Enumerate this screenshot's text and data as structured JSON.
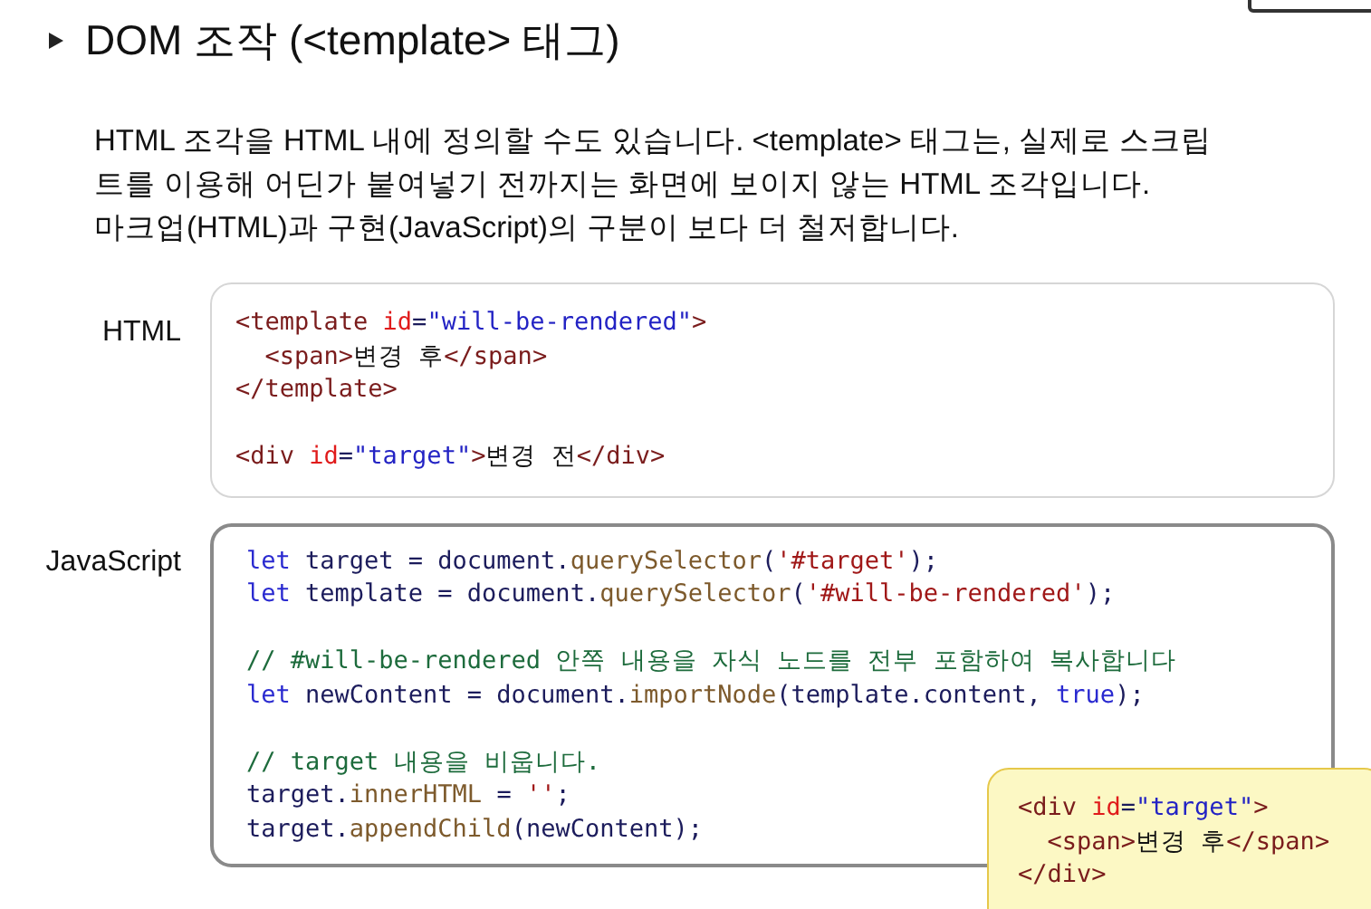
{
  "title": "DOM 조작 (<template> 태그)",
  "description": "HTML 조각을 HTML 내에 정의할 수도 있습니다. <template> 태그는, 실제로 스크립\n트를 이용해 어딘가 붙여넣기 전까지는 화면에 보이지 않는 HTML 조각입니다.\n마크업(HTML)과 구현(JavaScript)의 구분이 보다 더 철저합니다.",
  "panels": [
    {
      "label": "HTML",
      "lines": [
        {
          "kind": "code",
          "tokens": [
            {
              "text": "<template ",
              "kind": "tag"
            },
            {
              "text": "id",
              "kind": "attr"
            },
            {
              "text": "=",
              "kind": "plain"
            },
            {
              "text": "\"will-be-rendered\"",
              "kind": "str"
            },
            {
              "text": ">",
              "kind": "tag"
            }
          ]
        },
        {
          "kind": "code",
          "tokens": [
            {
              "text": "  <span>",
              "kind": "tag"
            },
            {
              "text": "변경 후",
              "kind": "text"
            },
            {
              "text": "</span>",
              "kind": "tag"
            }
          ]
        },
        {
          "kind": "code",
          "tokens": [
            {
              "text": "</template>",
              "kind": "tag"
            }
          ]
        },
        {
          "kind": "blank"
        },
        {
          "kind": "code",
          "tokens": [
            {
              "text": "<div ",
              "kind": "tag"
            },
            {
              "text": "id",
              "kind": "attr"
            },
            {
              "text": "=",
              "kind": "plain"
            },
            {
              "text": "\"target\"",
              "kind": "str"
            },
            {
              "text": ">",
              "kind": "tag"
            },
            {
              "text": "변경 전",
              "kind": "text"
            },
            {
              "text": "</div>",
              "kind": "tag"
            }
          ]
        }
      ]
    },
    {
      "label": "JavaScript",
      "lines": [
        {
          "kind": "code",
          "tokens": [
            {
              "text": "let ",
              "kind": "kw"
            },
            {
              "text": "target = document.",
              "kind": "plain"
            },
            {
              "text": "querySelector",
              "kind": "fn"
            },
            {
              "text": "(",
              "kind": "plain"
            },
            {
              "text": "'#target'",
              "kind": "jsstr"
            },
            {
              "text": ");",
              "kind": "plain"
            }
          ]
        },
        {
          "kind": "code",
          "tokens": [
            {
              "text": "let ",
              "kind": "kw"
            },
            {
              "text": "template = document.",
              "kind": "plain"
            },
            {
              "text": "querySelector",
              "kind": "fn"
            },
            {
              "text": "(",
              "kind": "plain"
            },
            {
              "text": "'#will-be-rendered'",
              "kind": "jsstr"
            },
            {
              "text": ");",
              "kind": "plain"
            }
          ]
        },
        {
          "kind": "blank"
        },
        {
          "kind": "code",
          "tokens": [
            {
              "text": "// #will-be-rendered 안쪽 내용을 자식 노드를 전부 포함하여 복사합니다",
              "kind": "comment"
            }
          ]
        },
        {
          "kind": "code",
          "tokens": [
            {
              "text": "let ",
              "kind": "kw"
            },
            {
              "text": "newContent = document.",
              "kind": "plain"
            },
            {
              "text": "importNode",
              "kind": "fn"
            },
            {
              "text": "(template.content, ",
              "kind": "plain"
            },
            {
              "text": "true",
              "kind": "kw"
            },
            {
              "text": ");",
              "kind": "plain"
            }
          ]
        },
        {
          "kind": "blank"
        },
        {
          "kind": "code",
          "tokens": [
            {
              "text": "// target 내용을 비웁니다.",
              "kind": "comment"
            }
          ]
        },
        {
          "kind": "code",
          "tokens": [
            {
              "text": "target.",
              "kind": "plain"
            },
            {
              "text": "innerHTML",
              "kind": "fn"
            },
            {
              "text": " = ",
              "kind": "plain"
            },
            {
              "text": "''",
              "kind": "jsstr"
            },
            {
              "text": ";",
              "kind": "plain"
            }
          ]
        },
        {
          "kind": "code",
          "tokens": [
            {
              "text": "target.",
              "kind": "plain"
            },
            {
              "text": "appendChild",
              "kind": "fn"
            },
            {
              "text": "(newContent);",
              "kind": "plain"
            }
          ]
        }
      ]
    }
  ],
  "result_note": {
    "lines": [
      {
        "kind": "code",
        "tokens": [
          {
            "text": "<div ",
            "kind": "tag"
          },
          {
            "text": "id",
            "kind": "attr"
          },
          {
            "text": "=",
            "kind": "plain"
          },
          {
            "text": "\"target\"",
            "kind": "str"
          },
          {
            "text": ">",
            "kind": "tag"
          }
        ]
      },
      {
        "kind": "code",
        "tokens": [
          {
            "text": "  <span>",
            "kind": "tag"
          },
          {
            "text": "변경 후",
            "kind": "text"
          },
          {
            "text": "</span>",
            "kind": "tag"
          }
        ]
      },
      {
        "kind": "code",
        "tokens": [
          {
            "text": "</div>",
            "kind": "tag"
          }
        ]
      }
    ]
  }
}
